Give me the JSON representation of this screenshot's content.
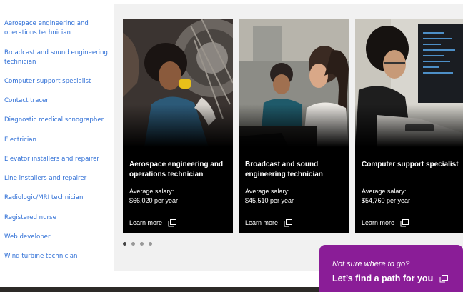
{
  "sidebar": {
    "items": [
      {
        "label": "Aerospace engineering and operations technician"
      },
      {
        "label": "Broadcast and sound engineering technician"
      },
      {
        "label": "Computer support specialist"
      },
      {
        "label": "Contact tracer"
      },
      {
        "label": "Diagnostic medical sonographer"
      },
      {
        "label": "Electrician"
      },
      {
        "label": "Elevator installers and repairer"
      },
      {
        "label": "Line installers and repairer"
      },
      {
        "label": "Radiologic/MRI technician"
      },
      {
        "label": "Registered nurse"
      },
      {
        "label": "Web developer"
      },
      {
        "label": "Wind turbine technician"
      }
    ]
  },
  "cards": [
    {
      "title": "Aerospace engineering and operations technician",
      "salary_label": "Average salary:",
      "salary": "$66,020 per year",
      "link": "Learn more"
    },
    {
      "title": "Broadcast and sound engineering technician",
      "salary_label": "Average salary:",
      "salary": "$45,510 per year",
      "link": "Learn more"
    },
    {
      "title": "Computer support specialist",
      "salary_label": "Average salary:",
      "salary": "$54,760 per year",
      "link": "Learn more"
    }
  ],
  "carousel": {
    "page_count": 4,
    "active_page": 1
  },
  "cta": {
    "subtitle": "Not sure where to go?",
    "title": "Let’s find a path for you"
  },
  "colors": {
    "link": "#2f6fd6",
    "cta": "#8a1d97",
    "panel": "#f1f1f1",
    "card": "#000000"
  },
  "icons": {
    "external": "external-link-icon"
  }
}
